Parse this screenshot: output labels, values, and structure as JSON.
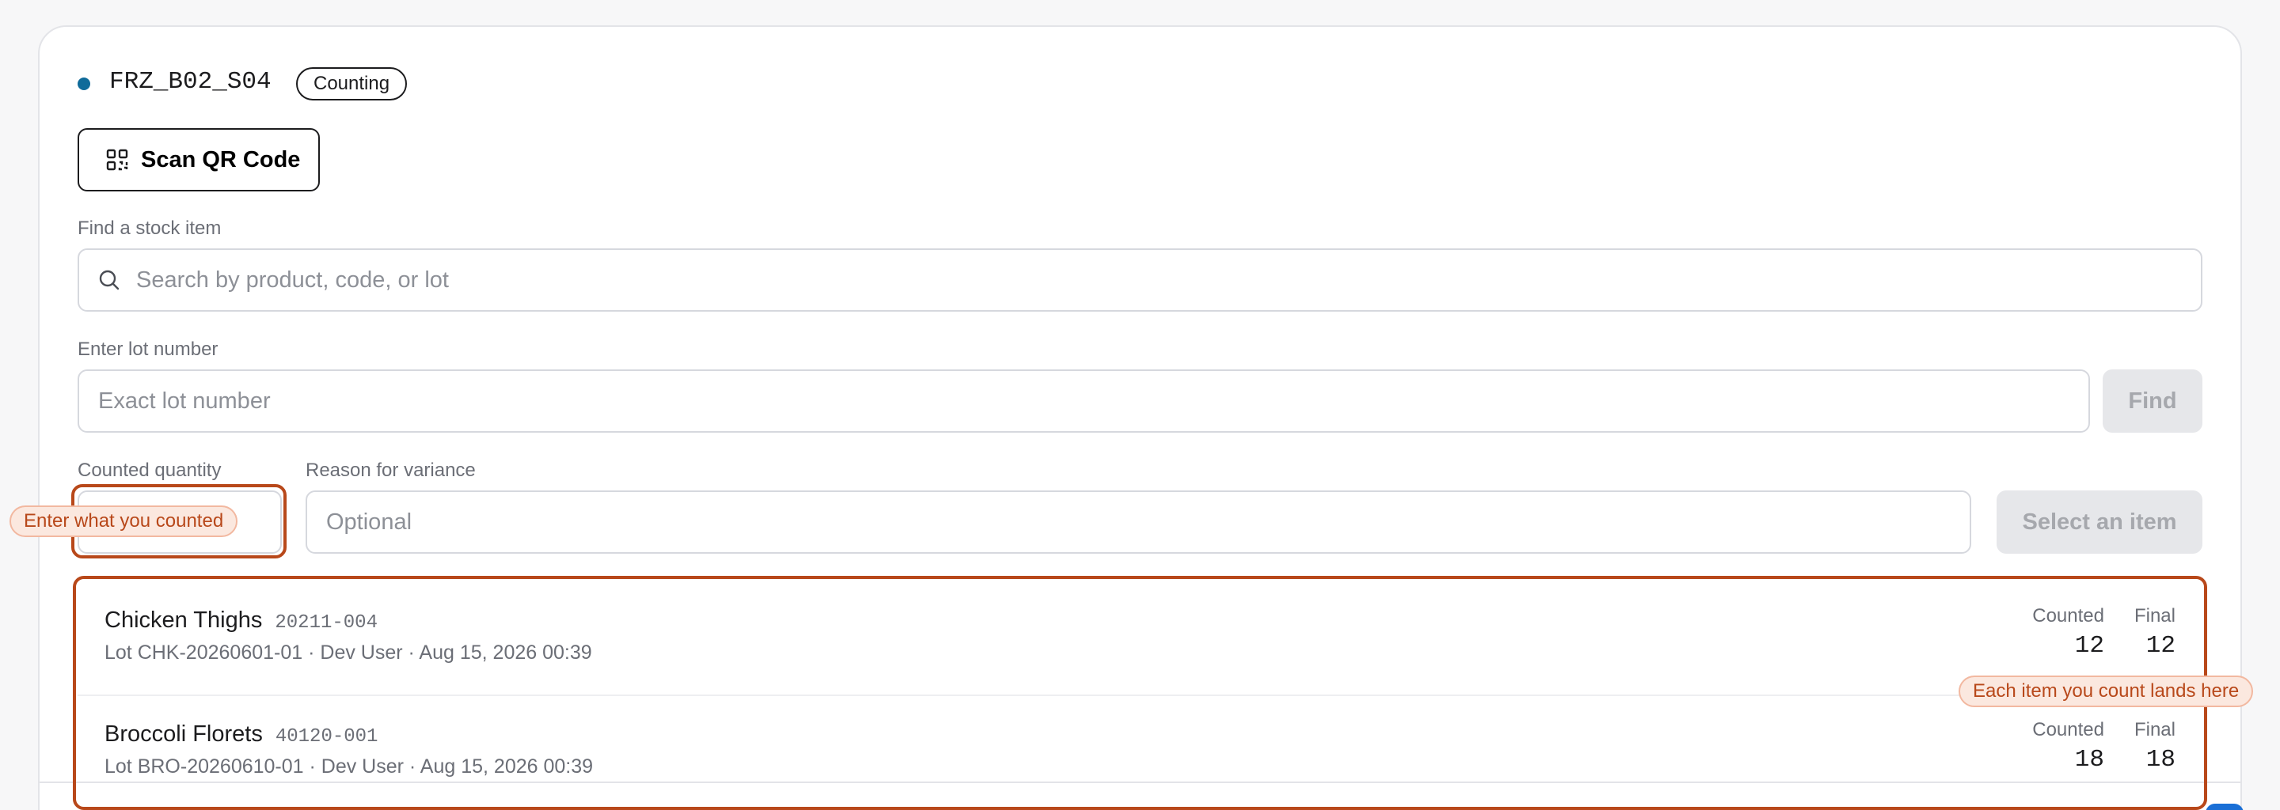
{
  "location": {
    "code": "FRZ_B02_S04",
    "status": "Counting",
    "dot_color": "#0f6b9a"
  },
  "scan_button": {
    "label": "Scan QR Code",
    "icon": "qr-code-icon"
  },
  "search": {
    "label": "Find a stock item",
    "placeholder": "Search by product, code, or lot",
    "icon": "search-icon"
  },
  "lot": {
    "label": "Enter lot number",
    "placeholder": "Exact lot number",
    "button": "Find"
  },
  "count": {
    "quantity_label": "Counted quantity",
    "quantity_value": "",
    "reason_label": "Reason for variance",
    "reason_placeholder": "Optional",
    "submit_label": "Select an item"
  },
  "callouts": {
    "quantity": "Enter what you counted",
    "list": "Each item you count lands here",
    "accent_color": "#b8481a"
  },
  "items": [
    {
      "name": "Chicken Thighs",
      "code": "20211-004",
      "meta": "Lot CHK-20260601-01 · Dev User · Aug 15, 2026 00:39",
      "counted_label": "Counted",
      "counted": "12",
      "final_label": "Final",
      "final": "12"
    },
    {
      "name": "Broccoli Florets",
      "code": "40120-001",
      "meta": "Lot BRO-20260610-01 · Dev User · Aug 15, 2026 00:39",
      "counted_label": "Counted",
      "counted": "18",
      "final_label": "Final",
      "final": "18"
    }
  ]
}
